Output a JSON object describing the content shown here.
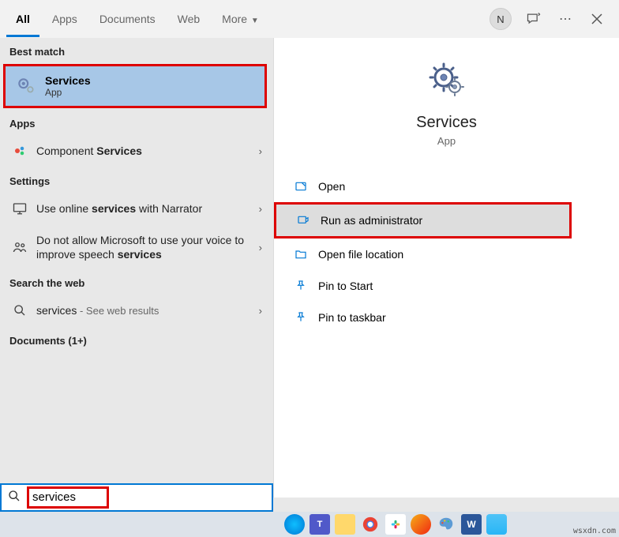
{
  "tabs": {
    "all": "All",
    "apps": "Apps",
    "docs": "Documents",
    "web": "Web",
    "more": "More"
  },
  "user_initial": "N",
  "sections": {
    "best_match": "Best match",
    "apps": "Apps",
    "settings": "Settings",
    "web": "Search the web",
    "docs_plus": "Documents (1+)"
  },
  "best": {
    "title": "Services",
    "subtitle": "App"
  },
  "app_item": {
    "pre": "Component ",
    "bold": "Services"
  },
  "setting1": {
    "pre": "Use online ",
    "bold": "services",
    "post": " with Narrator"
  },
  "setting2": {
    "line": "Do not allow Microsoft to use your voice to improve speech ",
    "bold": "services"
  },
  "web_item": {
    "term": "services",
    "hint": " - See web results"
  },
  "preview": {
    "title": "Services",
    "subtitle": "App"
  },
  "actions": {
    "open": "Open",
    "runas": "Run as administrator",
    "openloc": "Open file location",
    "pinstart": "Pin to Start",
    "pintask": "Pin to taskbar"
  },
  "search_value": "services",
  "watermark": "wsxdn.com"
}
